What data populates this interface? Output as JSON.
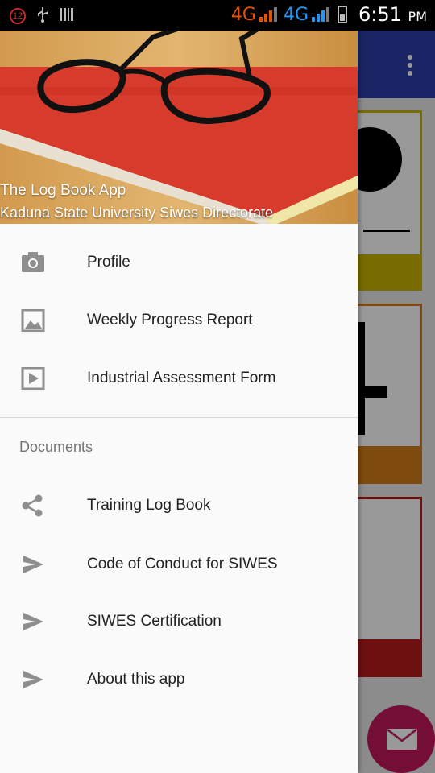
{
  "status_bar": {
    "notification_count": "12",
    "network_1": "4G",
    "network_2": "4G",
    "time": "6:51",
    "ampm": "PM"
  },
  "drawer": {
    "header": {
      "title": "The Log Book App",
      "subtitle": "Kaduna State University Siwes Directorate"
    },
    "items": [
      {
        "label": "Profile",
        "icon": "camera-icon"
      },
      {
        "label": "Weekly Progress Report",
        "icon": "image-icon"
      },
      {
        "label": "Industrial Assessment Form",
        "icon": "play-icon"
      }
    ],
    "section_title": "Documents",
    "documents": [
      {
        "label": "Training Log Book",
        "icon": "share-icon"
      },
      {
        "label": "Code of Conduct for SIWES",
        "icon": "send-icon"
      },
      {
        "label": "SIWES Certification",
        "icon": "send-icon"
      },
      {
        "label": "About this app",
        "icon": "send-icon"
      }
    ]
  },
  "colors": {
    "app_bar": "#2a3fa8",
    "fab": "#c2185b",
    "accent_orange": "#e65100",
    "card_yellow": "#c8b400",
    "card_orange": "#d47c18",
    "card_red": "#b71c1c"
  }
}
